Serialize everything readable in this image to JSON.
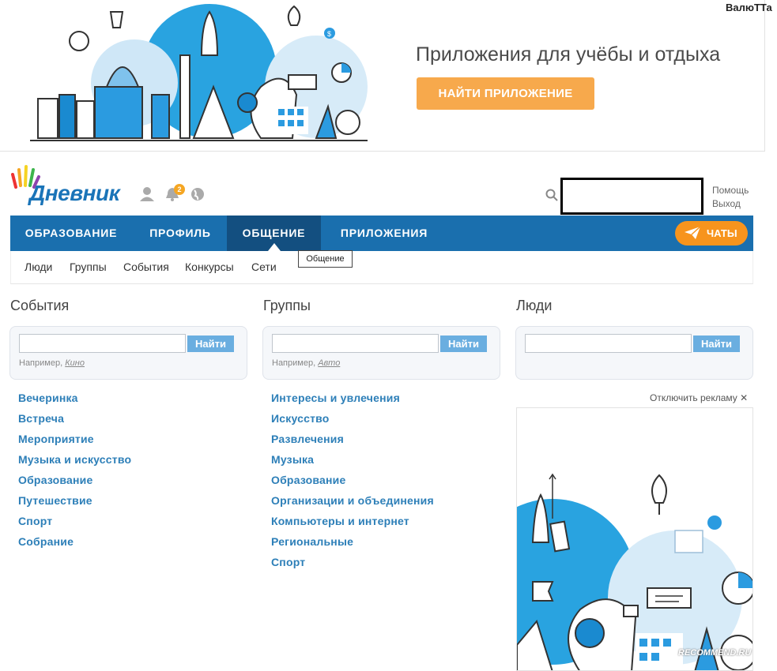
{
  "user": {
    "name": "ВалюТТа"
  },
  "banner": {
    "title": "Приложения для учёбы и отдыха",
    "button": "НАЙТИ ПРИЛОЖЕНИЕ",
    "coin_symbol": "$"
  },
  "logo": {
    "text": "Дневник"
  },
  "header": {
    "notifications_count": "2",
    "help": "Помощь",
    "logout": "Выход"
  },
  "nav": {
    "items": [
      "ОБРАЗОВАНИЕ",
      "ПРОФИЛЬ",
      "ОБЩЕНИЕ",
      "ПРИЛОЖЕНИЯ"
    ],
    "active": "ОБЩЕНИЕ",
    "chat": "ЧАТЫ",
    "tooltip": "Общение"
  },
  "subnav": {
    "items": [
      "Люди",
      "Группы",
      "События",
      "Конкурсы",
      "Сети"
    ]
  },
  "columns": {
    "events": {
      "title": "События",
      "button": "Найти",
      "example_prefix": "Например, ",
      "example": "Кино",
      "links": [
        "Вечеринка",
        "Встреча",
        "Мероприятие",
        "Музыка и искусство",
        "Образование",
        "Путешествие",
        "Спорт",
        "Собрание"
      ]
    },
    "groups": {
      "title": "Группы",
      "button": "Найти",
      "example_prefix": "Например, ",
      "example": "Авто",
      "links": [
        "Интересы и увлечения",
        "Искусство",
        "Развлечения",
        "Музыка",
        "Образование",
        "Организации и объединения",
        "Компьютеры и интернет",
        "Региональные",
        "Спорт"
      ]
    },
    "people": {
      "title": "Люди",
      "button": "Найти"
    }
  },
  "ad": {
    "disable": "Отключить рекламу",
    "close_symbol": "✕"
  },
  "watermark": "RECOMMEND.RU",
  "colors": {
    "nav": "#1a6fae",
    "nav_active": "#134f80",
    "accent_orange": "#f7a94c",
    "link": "#2d7fb8"
  }
}
